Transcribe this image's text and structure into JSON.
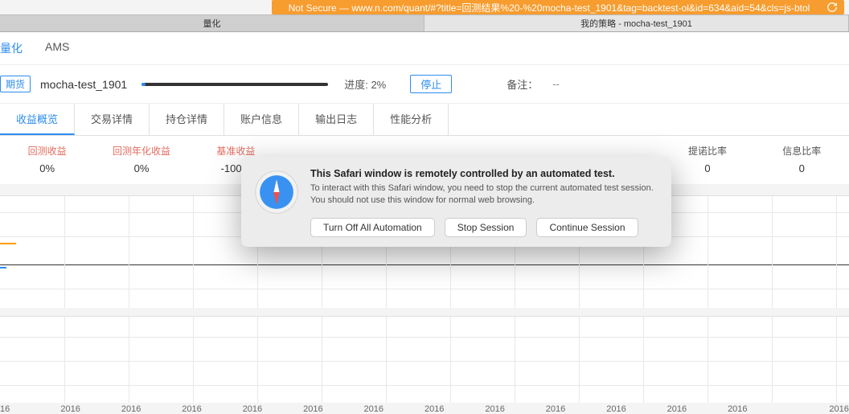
{
  "url_bar": {
    "not_secure": "Not Secure —",
    "url": "www.n.com/quant/#?title=回测结果%20-%20mocha-test_1901&tag=backtest-ol&id=634&aid=54&cls=js-btol"
  },
  "browser_tabs": [
    {
      "label": "量化"
    },
    {
      "label": "我的策略 - mocha-test_1901",
      "active": true
    }
  ],
  "nav": {
    "items": [
      "量化",
      "AMS"
    ]
  },
  "strategy": {
    "tag": "期货",
    "name": "mocha-test_1901",
    "progress_label": "进度:",
    "progress_text": "2%",
    "stop_label": "停止",
    "remark_label": "备注：",
    "remark_value": "--"
  },
  "subtabs": [
    "收益概览",
    "交易详情",
    "持仓详情",
    "账户信息",
    "输出日志",
    "性能分析"
  ],
  "metrics": [
    {
      "label": "回测收益",
      "value": "0%"
    },
    {
      "label": "回测年化收益",
      "value": "0%"
    },
    {
      "label": "基准收益",
      "value": "-100%"
    },
    {
      "label": "",
      "value": ""
    },
    {
      "label": "",
      "value": ""
    },
    {
      "label": "",
      "value": ""
    },
    {
      "label": "",
      "value": ""
    },
    {
      "label": "提诺比率",
      "value": "0"
    },
    {
      "label": "信息比率",
      "value": "0"
    }
  ],
  "chart_data": {
    "type": "line",
    "x_ticks": [
      "16",
      "2016",
      "2016",
      "2016",
      "2016",
      "2016",
      "2016",
      "2016",
      "2016",
      "2016",
      "2016",
      "2016",
      "2016",
      "2016"
    ],
    "series": [
      {
        "name": "回测收益",
        "color": "#ff9a00"
      },
      {
        "name": "基准收益",
        "color": "#2d8cf0"
      }
    ]
  },
  "modal": {
    "title": "This Safari window is remotely controlled by an automated test.",
    "line1": "To interact with this Safari window, you need to stop the current automated test session.",
    "line2": "You should not use this window for normal web browsing.",
    "btn_turnoff": "Turn Off All Automation",
    "btn_stop": "Stop Session",
    "btn_continue": "Continue Session"
  }
}
